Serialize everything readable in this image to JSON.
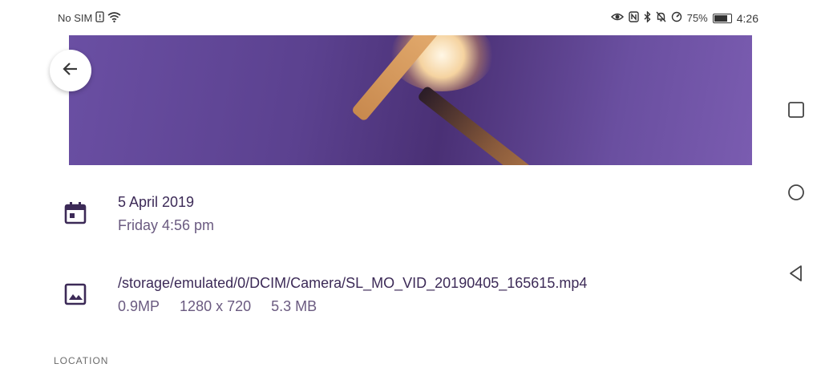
{
  "status_bar": {
    "carrier": "No SIM",
    "battery_percent_label": "75%",
    "battery_level": 0.75,
    "time": "4:26"
  },
  "details": {
    "date": "5 April 2019",
    "day_time": "Friday 4:56 pm",
    "file_path": "/storage/emulated/0/DCIM/Camera/SL_MO_VID_20190405_165615.mp4",
    "megapixels": "0.9MP",
    "resolution": "1280 x 720",
    "file_size": "5.3 MB"
  },
  "section": {
    "location_label": "LOCATION"
  },
  "colors": {
    "accent": "#3c2a57",
    "secondary_text": "#6a5a80",
    "media_tint": "#5b418f"
  },
  "icons": [
    "back-arrow-icon",
    "calendar-icon",
    "image-icon",
    "square-nav-icon",
    "circle-nav-icon",
    "triangle-nav-icon"
  ]
}
